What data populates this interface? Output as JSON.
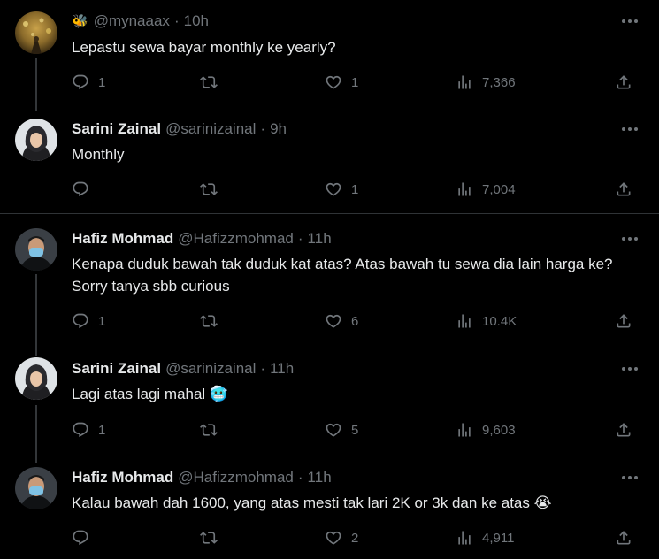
{
  "tweets": [
    {
      "name": "",
      "handle": "@mynaaax",
      "time": "10h",
      "text": "Lepastu sewa bayar monthly ke yearly?",
      "replies": "1",
      "retweets": "",
      "likes": "1",
      "views": "7,366"
    },
    {
      "name": "Sarini Zainal",
      "handle": "@sarinizainal",
      "time": "9h",
      "text": "Monthly",
      "replies": "",
      "retweets": "",
      "likes": "1",
      "views": "7,004"
    },
    {
      "name": "Hafiz Mohmad",
      "handle": "@Hafizzmohmad",
      "time": "11h",
      "text": "Kenapa duduk bawah tak duduk kat atas? Atas bawah tu sewa dia lain harga ke? Sorry tanya sbb curious",
      "replies": "1",
      "retweets": "",
      "likes": "6",
      "views": "10.4K"
    },
    {
      "name": "Sarini Zainal",
      "handle": "@sarinizainal",
      "time": "11h",
      "text": "Lagi atas lagi mahal 🥶",
      "replies": "1",
      "retweets": "",
      "likes": "5",
      "views": "9,603"
    },
    {
      "name": "Hafiz Mohmad",
      "handle": "@Hafizzmohmad",
      "time": "11h",
      "text": "Kalau bawah dah 1600, yang atas mesti tak lari 2K or 3k dan ke atas 😭",
      "replies": "",
      "retweets": "",
      "likes": "2",
      "views": "4,911"
    }
  ],
  "icons": {
    "reply": "reply-icon",
    "retweet": "retweet-icon",
    "like": "heart-icon",
    "views": "views-icon",
    "share": "share-icon",
    "more": "more-icon",
    "bee": "bee-emoji"
  },
  "colors": {
    "background": "#000000",
    "primary_text": "#e7e9ea",
    "secondary_text": "#71767b",
    "divider": "#2f3336"
  }
}
